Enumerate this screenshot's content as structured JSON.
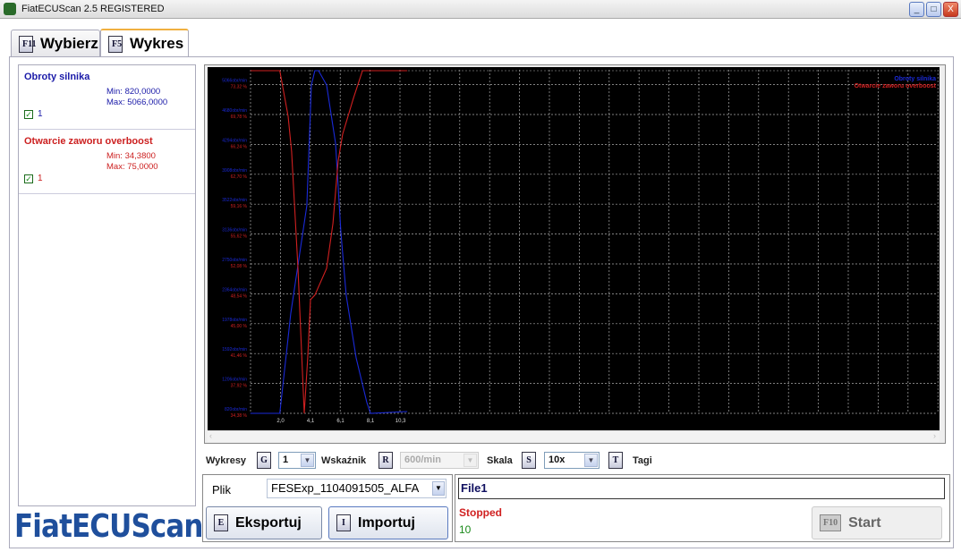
{
  "window": {
    "title": "FiatECUScan 2.5 REGISTERED",
    "controls": [
      "_",
      "□",
      "X"
    ]
  },
  "tabs": [
    {
      "key": "F11",
      "label": "Wybierz"
    },
    {
      "key": "F5",
      "label": "Wykres",
      "active": true
    }
  ],
  "signals": [
    {
      "name": "Obroty silnika",
      "min": "Min: 820,0000",
      "max": "Max: 5066,0000",
      "checked": true,
      "channel": "1",
      "color": "#1a1aa8"
    },
    {
      "name": "Otwarcie zaworu overboost",
      "min": "Min: 34,3800",
      "max": "Max: 75,0000",
      "checked": true,
      "channel": "1",
      "color": "#cc2020"
    }
  ],
  "logo": "FiatECUScan",
  "controls": {
    "wykresy_label": "Wykresy",
    "wykresy_key": "G",
    "wykresy_value": "1",
    "wskaznik_label": "Wskaźnik",
    "wskaznik_key": "R",
    "wskaznik_value": "600/min",
    "skala_label": "Skala",
    "skala_key": "S",
    "skala_value": "10x",
    "tagi_key": "T",
    "tagi_label": "Tagi"
  },
  "file": {
    "label": "Plik",
    "value": "FESExp_1104091505_ALFA",
    "export_key": "E",
    "export_label": "Eksportuj",
    "import_key": "I",
    "import_label": "Importuj"
  },
  "status": {
    "name": "File1",
    "state": "Stopped",
    "count": "10",
    "start_key": "F10",
    "start_label": "Start"
  },
  "chart_data": {
    "type": "line",
    "xlabel": "",
    "x_tick_labels": [
      "2,0",
      "4,1",
      "6,1",
      "8,1",
      "10,3"
    ],
    "x_ticks": [
      2.05,
      4.1,
      6.15,
      8.2,
      10.25
    ],
    "xlim": [
      0,
      47.0
    ],
    "legend": [
      "Obroty silnika",
      "Otwarcie zaworu overboost"
    ],
    "legend_position": "top-right",
    "grid": true,
    "series": [
      {
        "name": "Obroty silnika",
        "color": "#1a2ad8",
        "ylim": [
          820,
          5066
        ],
        "y_tick_labels": [
          "5066obr/min",
          "4680obr/min",
          "4294obr/min",
          "3908obr/min",
          "3522obr/min",
          "3136obr/min",
          "2750obr/min",
          "2364obr/min",
          "1978obr/min",
          "1592obr/min",
          "1206obr/min",
          "820obr/min"
        ],
        "x": [
          0,
          2.0,
          2.75,
          3.85,
          4.16,
          4.4,
          4.65,
          5.2,
          5.81,
          6.18,
          6.54,
          7.22,
          7.95,
          8.2,
          10.7
        ],
        "y": [
          820,
          820,
          2062,
          3392,
          4889,
          5066,
          5066,
          4889,
          4168,
          3059,
          2283,
          1507,
          953,
          820,
          842
        ]
      },
      {
        "name": "Otwarcie zaworu overboost",
        "color": "#d02020",
        "ylim": [
          34.38,
          75
        ],
        "y_tick_labels": [
          "73,32 %",
          "69,78 %",
          "66,24 %",
          "62,70 %",
          "59,16 %",
          "55,62 %",
          "52,08 %",
          "48,54 %",
          "45,00 %",
          "41,46 %",
          "37,92 %",
          "34,38 %"
        ],
        "x": [
          0,
          2.0,
          2.57,
          2.81,
          3.24,
          3.67,
          3.91,
          4.1,
          4.4,
          5.2,
          5.63,
          5.99,
          6.3,
          7.03,
          7.65,
          10.7
        ],
        "y": [
          75,
          75,
          69.6,
          65.4,
          51.6,
          34.38,
          40.96,
          47.85,
          48.4,
          51.56,
          56.9,
          64.3,
          67.5,
          71.7,
          75,
          75
        ]
      }
    ]
  }
}
